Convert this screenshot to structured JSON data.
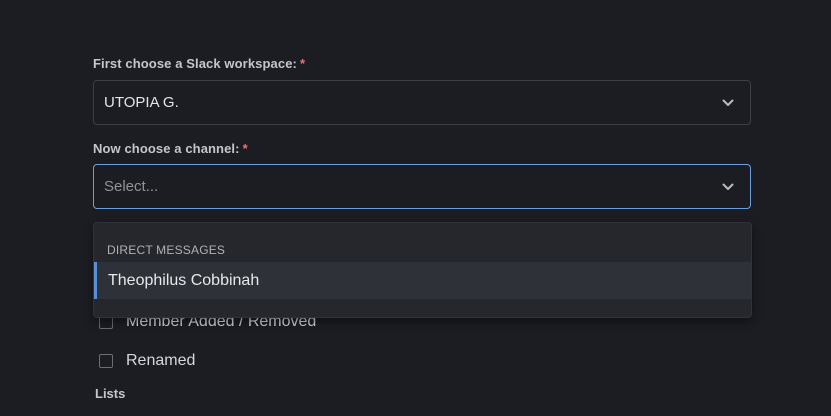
{
  "workspace_field": {
    "label": "First choose a Slack workspace:",
    "required_mark": "*",
    "value": "UTOPIA G."
  },
  "channel_field": {
    "label": "Now choose a channel:",
    "required_mark": "*",
    "placeholder": "Select..."
  },
  "channel_dropdown": {
    "groups": [
      {
        "header": "DIRECT MESSAGES",
        "options": [
          "Theophilus Cobbinah"
        ]
      }
    ]
  },
  "events": {
    "options": [
      {
        "label": "Member Added / Removed",
        "checked": false
      },
      {
        "label": "Renamed",
        "checked": false
      }
    ]
  },
  "lists_section": {
    "label": "Lists"
  },
  "colors": {
    "background": "#1c1d22",
    "focus_border": "#6d9fe0",
    "required": "#f0707a",
    "option_highlight": "#2e3137"
  },
  "icons": {
    "dropdown_indicator": "chevron-down-icon"
  }
}
